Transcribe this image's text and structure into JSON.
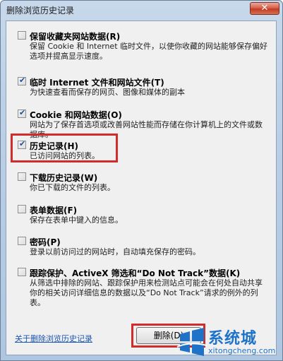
{
  "window": {
    "title": "删除浏览历史记录",
    "close_glyph": "✕"
  },
  "options": [
    {
      "label": "保留收藏夹网站数据(R)",
      "checked": false,
      "desc": "保留 Cookie 和 Internet 临时文件，以使你收藏的网站能够保存偏好选项并提高显示速度。"
    },
    {
      "label": "临时 Internet 文件和网站文件(T)",
      "checked": true,
      "desc": "为快速查看而保存的网页、图像和媒体的副本"
    },
    {
      "label": "Cookie 和网站数据(O)",
      "checked": true,
      "desc": "网站为了保存首选项或改善网站性能而存储在你计算机上的文件或数据库。"
    },
    {
      "label": "历史记录(H)",
      "checked": true,
      "desc": "已访问网站的列表。"
    },
    {
      "label": "下载历史记录(W)",
      "checked": false,
      "desc": "你已下载的文件的列表。"
    },
    {
      "label": "表单数据(F)",
      "checked": false,
      "desc": "保存在表单中键入的信息。"
    },
    {
      "label": "密码(P)",
      "checked": false,
      "desc": "登录以前访问过的网站时，自动填充保存的密码。"
    },
    {
      "label": "跟踪保护、ActiveX 筛选和“Do Not Track”数据(K)",
      "checked": false,
      "desc": "从筛选中排除的网站、跟踪保护用来检测站点可能会在何处自动共享你的相关访问详细信息的数据以及“Do Not Track”请求的例外的列表。"
    }
  ],
  "about_link": "关于删除浏览历史记录",
  "delete_button": "删除(D)",
  "watermark": {
    "name": "系统城",
    "url": "xitongcheng.com"
  },
  "colors": {
    "highlight": "#d12b2b",
    "link": "#1a55b4",
    "watermark": "#1e73c8"
  }
}
